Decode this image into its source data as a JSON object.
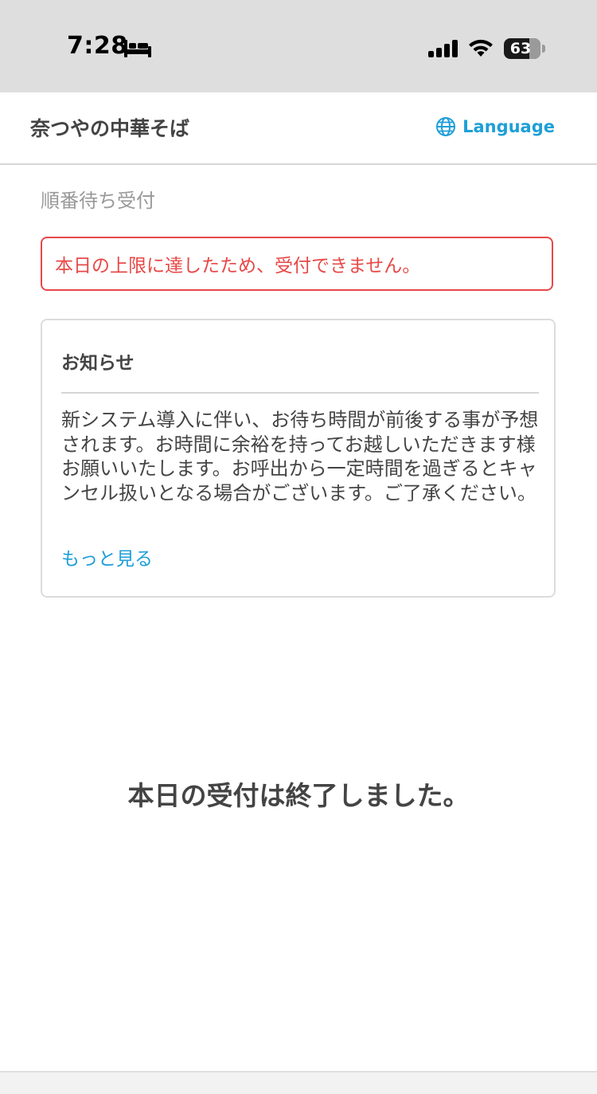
{
  "status_bar": {
    "time": "7:28",
    "battery_percent": "63",
    "icons": [
      "bed-icon",
      "signal-icon",
      "wifi-icon",
      "battery-icon"
    ]
  },
  "header": {
    "shop_name": "奈つやの中華そば",
    "language_label": "Language",
    "icon": "globe-icon"
  },
  "section": {
    "label": "順番待ち受付"
  },
  "error": {
    "message": "本日の上限に達したため、受付できません。",
    "color": "#e84848"
  },
  "notice": {
    "title": "お知らせ",
    "body": "新システム導入に伴い、お待ち時間が前後する事が予想されます。お時間に余裕を持ってお越しいただきます様お願いいたします。お呼出から一定時間を過ぎるとキャンセル扱いとなる場合がございます。ご了承ください。",
    "more_label": "もっと見る"
  },
  "closed_message": "本日の受付は終了しました。",
  "colors": {
    "accent": "#1e9fd8",
    "error": "#e84848",
    "status_bar_bg": "#dedede"
  }
}
